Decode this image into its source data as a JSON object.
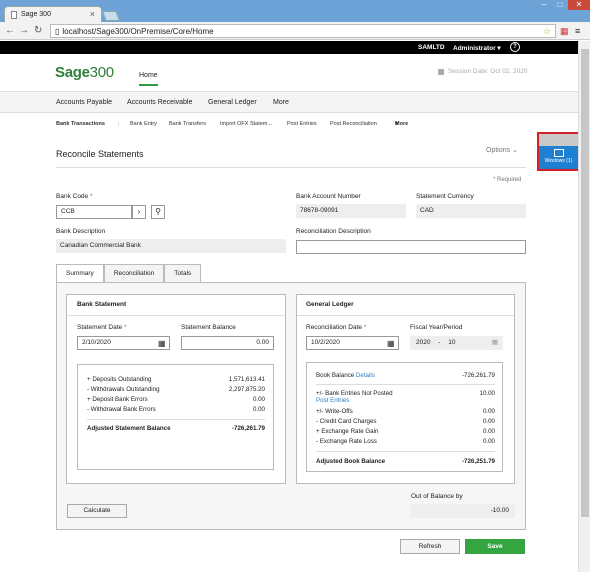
{
  "browser": {
    "tab_title": "Sage 300",
    "url": "localhost/Sage300/OnPremise/Core/Home"
  },
  "topbar": {
    "company": "SAMLTD",
    "user": "Administrator",
    "help": "?"
  },
  "header": {
    "logo_sage": "Sage",
    "logo_num": "300",
    "home": "Home",
    "session_date": "Session Date:  Oct 02, 2020"
  },
  "menu": [
    "Accounts Payable",
    "Accounts Receivable",
    "General Ledger",
    "More"
  ],
  "subnav": {
    "title": "Bank Transactions",
    "sep": ":",
    "items": [
      "Bank Entry",
      "Bank Transfers",
      "Import OFX Statem...",
      "Post Entries",
      "Post Reconciliation"
    ],
    "more": "More"
  },
  "page": {
    "title": "Reconcile Statements",
    "options": "Options",
    "required": "* Required"
  },
  "form": {
    "bank_code_label": "Bank Code",
    "bank_code": "CCB",
    "bank_account_label": "Bank Account Number",
    "bank_account": "78678-09091",
    "currency_label": "Statement Currency",
    "currency": "CAD",
    "bank_desc_label": "Bank Description",
    "bank_desc": "Canadian Commercial Bank",
    "recon_desc_label": "Reconciliation Description",
    "recon_desc": ""
  },
  "tabs": [
    "Summary",
    "Reconciliation",
    "Totals"
  ],
  "bank_statement": {
    "title": "Bank Statement",
    "date_label": "Statement Date",
    "date": "2/10/2020",
    "balance_label": "Statement Balance",
    "balance": "0.00",
    "rows": [
      {
        "label": "+ Deposits Outstanding",
        "value": "1,571,613.41"
      },
      {
        "label": "- Withdrawals Outstanding",
        "value": "2,297,875.20"
      },
      {
        "label": "+ Deposit Bank Errors",
        "value": "0.00"
      },
      {
        "label": "- Withdrawal Bank Errors",
        "value": "0.00"
      }
    ],
    "adjusted_label": "Adjusted Statement Balance",
    "adjusted": "-726,261.79"
  },
  "general_ledger": {
    "title": "General Ledger",
    "date_label": "Reconciliation Date",
    "date": "10/2/2020",
    "fiscal_label": "Fiscal Year/Period",
    "fiscal_year": "2020",
    "fiscal_sep": "-",
    "fiscal_period": "10",
    "book_label": "Book Balance",
    "details": "Details",
    "book_value": "-726,261.79",
    "not_posted_label": "+/- Bank Entries Not Posted",
    "post_entries": "Post Entries",
    "not_posted_value": "10.00",
    "rows": [
      {
        "label": "+/- Write-Offs",
        "value": "0.00"
      },
      {
        "label": "- Credit Card Charges",
        "value": "0.00"
      },
      {
        "label": "+ Exchange Rate Gain",
        "value": "0.00"
      },
      {
        "label": "- Exchange Rate Loss",
        "value": "0.00"
      }
    ],
    "adjusted_label": "Adjusted Book Balance",
    "adjusted": "-726,251.79"
  },
  "out_of_balance_label": "Out of Balance by",
  "out_of_balance": "-10.00",
  "buttons": {
    "calculate": "Calculate",
    "refresh": "Refresh",
    "save": "Save"
  },
  "windows_widget": "Windows (1)"
}
